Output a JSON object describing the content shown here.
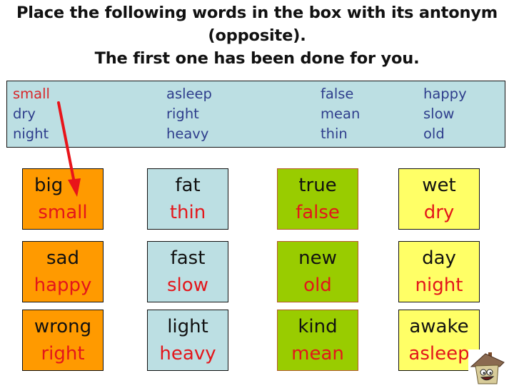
{
  "instructions": {
    "line1": "Place the following words in the box with its antonym",
    "line2": "(opposite).",
    "line3": "The first one has been done for you."
  },
  "word_bank": {
    "columns": [
      [
        {
          "word": "small",
          "used": true
        },
        {
          "word": "dry",
          "used": false
        },
        {
          "word": "night",
          "used": false
        }
      ],
      [
        {
          "word": "asleep",
          "used": false
        },
        {
          "word": "right",
          "used": false
        },
        {
          "word": "heavy",
          "used": false
        }
      ],
      [
        {
          "word": "false",
          "used": false
        },
        {
          "word": "mean",
          "used": false
        },
        {
          "word": "thin",
          "used": false
        }
      ],
      [
        {
          "word": "happy",
          "used": false
        },
        {
          "word": "slow",
          "used": false
        },
        {
          "word": "old",
          "used": false
        }
      ]
    ]
  },
  "boxes": [
    [
      {
        "word": "big",
        "antonym": "small",
        "color": "#ff9a00"
      },
      {
        "word": "fat",
        "antonym": "thin",
        "color": "#bcdfe3"
      },
      {
        "word": "true",
        "antonym": "false",
        "color": "#99cc00"
      },
      {
        "word": "wet",
        "antonym": "dry",
        "color": "#ffff66"
      }
    ],
    [
      {
        "word": "sad",
        "antonym": "happy",
        "color": "#ff9a00"
      },
      {
        "word": "fast",
        "antonym": "slow",
        "color": "#bcdfe3"
      },
      {
        "word": "new",
        "antonym": "old",
        "color": "#99cc00"
      },
      {
        "word": "day",
        "antonym": "night",
        "color": "#ffff66"
      }
    ],
    [
      {
        "word": "wrong",
        "antonym": "right",
        "color": "#ff9a00"
      },
      {
        "word": "light",
        "antonym": "heavy",
        "color": "#bcdfe3"
      },
      {
        "word": "kind",
        "antonym": "mean",
        "color": "#99cc00"
      },
      {
        "word": "awake",
        "antonym": "asleep",
        "color": "#ffff66"
      }
    ]
  ],
  "colors": {
    "bank_text": "#2e3d8c",
    "answer_text": "#e3161b",
    "arrow": "#e8141a"
  },
  "icons": {
    "example_arrow": "red-arrow-icon",
    "mascot": "house-mascot-icon"
  }
}
